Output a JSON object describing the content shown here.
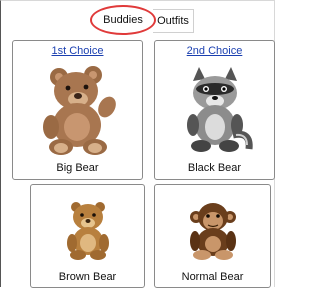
{
  "tabs": [
    {
      "label": "Buddies",
      "active": true
    },
    {
      "label": "Outfits",
      "active": false
    }
  ],
  "highlight_color": "#e03a3a",
  "cards": [
    {
      "choice": "1st Choice",
      "name": "Big Bear",
      "image": "brown-teddy-bear"
    },
    {
      "choice": "2nd Choice",
      "name": "Black Bear",
      "image": "raccoon-plush"
    },
    {
      "choice": "",
      "name": "Brown Bear",
      "image": "lion-cub-plush"
    },
    {
      "choice": "",
      "name": "Normal Bear",
      "image": "monkey-plush"
    }
  ]
}
